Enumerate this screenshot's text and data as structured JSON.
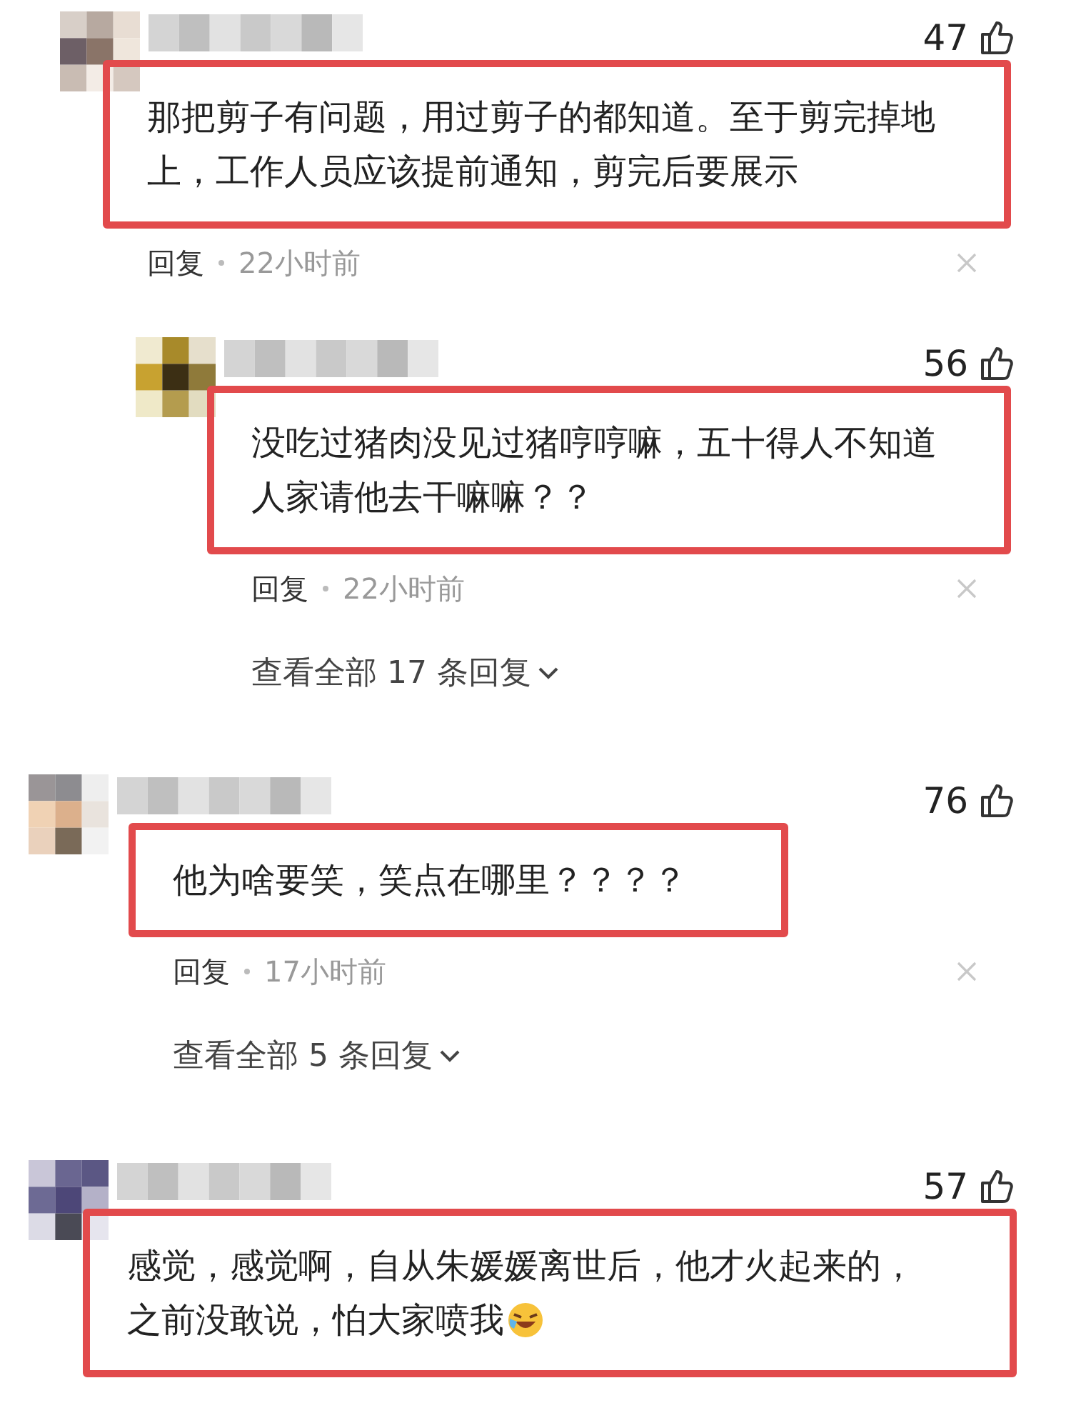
{
  "comments": [
    {
      "kind": "top",
      "likes": "47",
      "text": "那把剪子有问题，用过剪子的都知道。至于剪完掉地上，工作人员应该提前通知，剪完后要展示",
      "emoji": false,
      "reply_label": "回复",
      "time": "22小时前"
    },
    {
      "kind": "reply",
      "likes": "56",
      "text": "没吃过猪肉没见过猪哼哼嘛，五十得人不知道人家请他去干嘛嘛？？",
      "emoji": false,
      "reply_label": "回复",
      "time": "22小时前",
      "more": "查看全部 17 条回复"
    },
    {
      "kind": "top",
      "likes": "76",
      "text": "他为啥要笑，笑点在哪里？？？？",
      "emoji": false,
      "reply_label": "回复",
      "time": "17小时前",
      "more": "查看全部 5 条回复"
    },
    {
      "kind": "top",
      "likes": "57",
      "text": "感觉，感觉啊，自从朱媛媛离世后，他才火起来的，之前没敢说，怕大家喷我",
      "emoji": true
    }
  ]
}
